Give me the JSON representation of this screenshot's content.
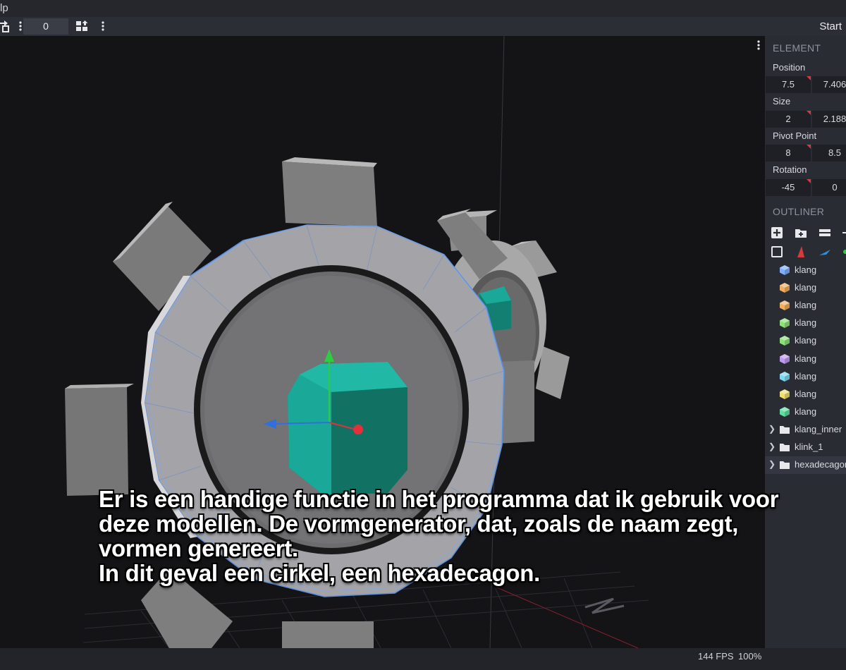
{
  "menubar": {
    "visible_menu": "lp"
  },
  "toolbar": {
    "number_value": "0",
    "start_label": "Start"
  },
  "element_panel": {
    "title": "ELEMENT",
    "position": {
      "label": "Position",
      "values": [
        "7.5",
        "7.406"
      ]
    },
    "size": {
      "label": "Size",
      "values": [
        "2",
        "2.188"
      ]
    },
    "pivot": {
      "label": "Pivot Point",
      "values": [
        "8",
        "8.5"
      ]
    },
    "rotation": {
      "label": "Rotation",
      "values": [
        "-45",
        "0"
      ]
    }
  },
  "outliner": {
    "title": "OUTLINER",
    "items": [
      {
        "label": "klang",
        "type": "cube",
        "color": "#7fb0ff"
      },
      {
        "label": "klang",
        "type": "cube",
        "color": "#f0b060"
      },
      {
        "label": "klang",
        "type": "cube",
        "color": "#f0b060"
      },
      {
        "label": "klang",
        "type": "cube",
        "color": "#8ee07a"
      },
      {
        "label": "klang",
        "type": "cube",
        "color": "#8ee07a"
      },
      {
        "label": "klang",
        "type": "cube",
        "color": "#c09cf0"
      },
      {
        "label": "klang",
        "type": "cube",
        "color": "#7fd8f0"
      },
      {
        "label": "klang",
        "type": "cube",
        "color": "#f0e070"
      },
      {
        "label": "klang",
        "type": "cube",
        "color": "#60e0a0"
      },
      {
        "label": "klang_inner",
        "type": "folder"
      },
      {
        "label": "klink_1",
        "type": "folder"
      },
      {
        "label": "hexadecagon",
        "type": "folder",
        "selected": true
      }
    ]
  },
  "status": {
    "fps": "144 FPS",
    "zoom": "100%"
  },
  "subtitle": {
    "lines": [
      "Er is een handige functie in het programma dat ik gebruik voor",
      "deze modellen. De vormgenerator, dat, zoals de naam zegt,",
      "vormen genereert.",
      "In dit geval een cirkel, een hexadecagon."
    ]
  },
  "colors": {
    "viewport_bg": "#141416",
    "panel_bg": "#2a2c33",
    "gear_face": "#6e6e6e",
    "teal_cube": "#17a596",
    "axis_x": "#e0313c",
    "axis_y": "#2ecc40",
    "axis_z": "#2f6fe0"
  }
}
